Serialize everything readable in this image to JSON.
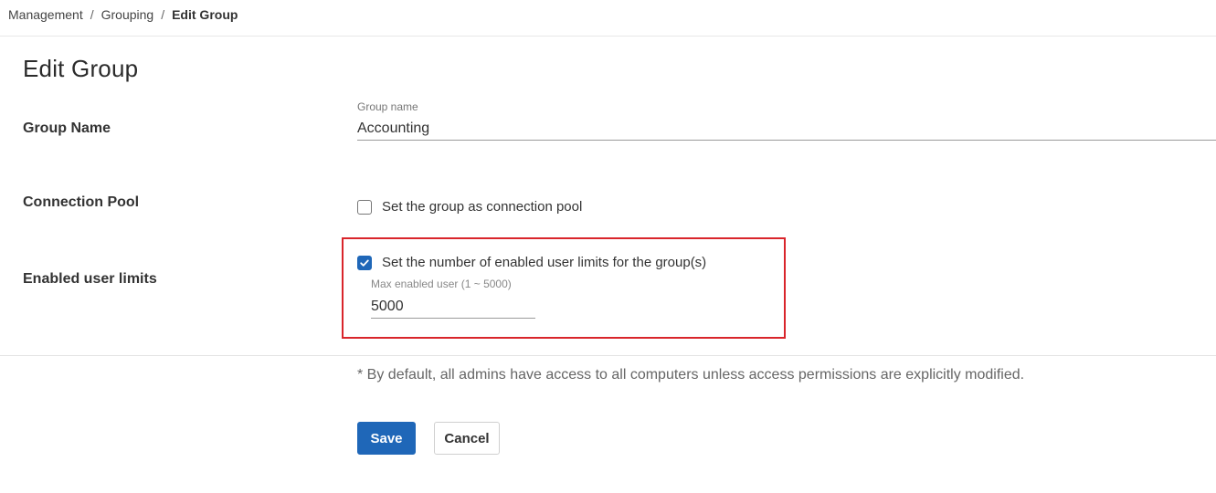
{
  "breadcrumb": {
    "items": [
      "Management",
      "Grouping"
    ],
    "current": "Edit Group",
    "separator": "/"
  },
  "page": {
    "title": "Edit Group"
  },
  "form": {
    "group_name": {
      "label": "Group Name",
      "caption": "Group name",
      "value": "Accounting"
    },
    "connection_pool": {
      "label": "Connection Pool",
      "checkbox_label": "Set the group as connection pool",
      "checked": false
    },
    "user_limits": {
      "label": "Enabled user limits",
      "checkbox_label": "Set the number of enabled user limits for the group(s)",
      "checked": true,
      "max_caption": "Max enabled user (1 ~ 5000)",
      "max_value": "5000"
    }
  },
  "footnote": "* By default, all admins have access to all computers unless access permissions are explicitly modified.",
  "actions": {
    "save": "Save",
    "cancel": "Cancel"
  },
  "colors": {
    "primary": "#1f67b8",
    "highlight": "#d9252b"
  }
}
